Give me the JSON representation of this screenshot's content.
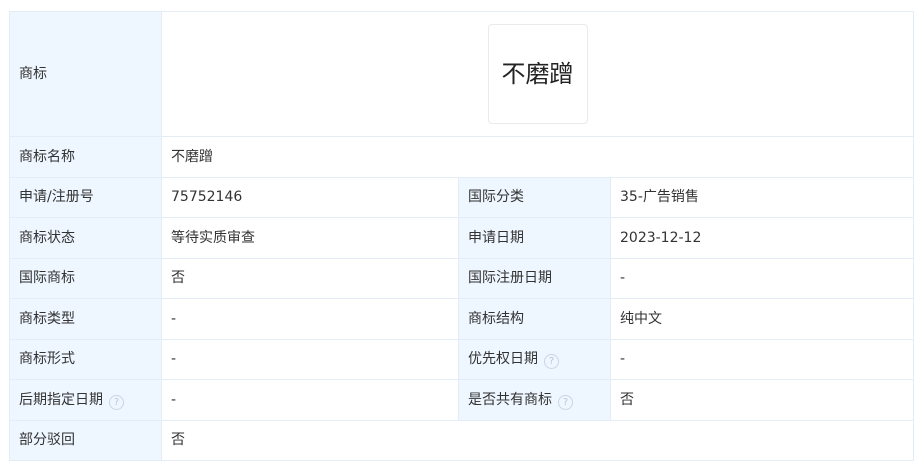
{
  "trademark_image": {
    "label": "商标",
    "text": "不磨蹭"
  },
  "rows": {
    "name": {
      "label": "商标名称",
      "value": "不磨蹭"
    },
    "reg_no": {
      "label": "申请/注册号",
      "value": "75752146"
    },
    "class": {
      "label": "国际分类",
      "value": "35-广告销售"
    },
    "status": {
      "label": "商标状态",
      "value": "等待实质审查"
    },
    "app_date": {
      "label": "申请日期",
      "value": "2023-12-12"
    },
    "intl_mark": {
      "label": "国际商标",
      "value": "否"
    },
    "intl_reg_date": {
      "label": "国际注册日期",
      "value": "-"
    },
    "mark_type": {
      "label": "商标类型",
      "value": "-"
    },
    "structure": {
      "label": "商标结构",
      "value": "纯中文"
    },
    "form": {
      "label": "商标形式",
      "value": "-"
    },
    "priority_date": {
      "label": "优先权日期",
      "value": "-",
      "icon": "help-icon"
    },
    "later_designation_date": {
      "label": "后期指定日期",
      "value": "-",
      "icon": "help-icon"
    },
    "shared_mark": {
      "label": "是否共有商标",
      "value": "否",
      "icon": "help-icon"
    },
    "partial_reject": {
      "label": "部分驳回",
      "value": "否"
    }
  },
  "icons": {
    "help_glyph": "?"
  },
  "colors": {
    "label_bg": "#eef6ff",
    "border": "#e4ecf5",
    "help_icon": "#b9c8d8"
  }
}
